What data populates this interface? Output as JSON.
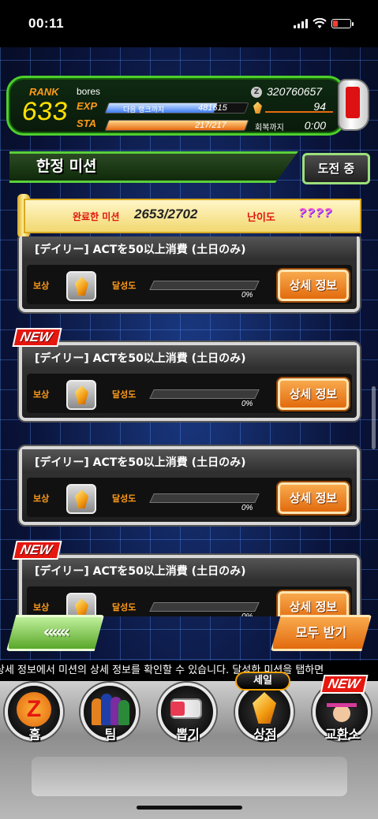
{
  "status_bar": {
    "time": "00:11"
  },
  "player": {
    "rank_label": "RANK",
    "rank": "633",
    "name": "bores",
    "exp_label": "EXP",
    "exp_next_label": "다음 랭크까지",
    "exp_value": "481615",
    "exp_progress": 0.78,
    "sta_label": "STA",
    "sta_value": "217/217",
    "sta_progress": 1.0,
    "zeni_icon": "Z",
    "zeni": "320760657",
    "dragon_stones": "94",
    "recover_label": "회복까지",
    "recover_time": "0:00"
  },
  "section": {
    "title": "한정 미션",
    "challenge_button": "도전 중"
  },
  "completed": {
    "label": "완료한 미션",
    "value": "2653/2702",
    "difficulty_label": "난이도",
    "difficulty_value": "????"
  },
  "missions": [
    {
      "title": "[デイリー] ACTを50以上消費 (土日のみ)",
      "reward_label": "보상",
      "progress_label": "달성도",
      "progress": "0%",
      "detail_button": "상세 정보",
      "new": false,
      "new_label": ""
    },
    {
      "title": "[デイリー] ACTを50以上消費 (土日のみ)",
      "reward_label": "보상",
      "progress_label": "달성도",
      "progress": "0%",
      "detail_button": "상세 정보",
      "new": true,
      "new_label": "NEW"
    },
    {
      "title": "[デイリー] ACTを50以上消費 (土日のみ)",
      "reward_label": "보상",
      "progress_label": "달성도",
      "progress": "0%",
      "detail_button": "상세 정보",
      "new": false,
      "new_label": ""
    },
    {
      "title": "[デイリー] ACTを50以上消費 (土日のみ)",
      "reward_label": "보상",
      "progress_label": "달성도",
      "progress": "0%",
      "detail_button": "상세 정보",
      "new": true,
      "new_label": "NEW"
    }
  ],
  "actions": {
    "back": "«««",
    "receive_all": "모두 받기"
  },
  "ticker": "상세 정보에서 미션의 상세 정보를 확인할 수 있습니다. 달성한 미션을 탭하면",
  "nav": {
    "home": "홈",
    "team": "팀",
    "gacha": "뽑기",
    "shop": "상점",
    "exchange": "교환소",
    "sale_badge": "세일",
    "new_badge": "NEW",
    "home_icon_letter": "Z"
  },
  "icons": {
    "reward": "dragon-stone-icon",
    "home": "dragon-ball-z-icon",
    "team": "team-characters-icon",
    "gacha": "summon-capsule-icon",
    "shop": "dragon-stone-icon",
    "exchange": "baba-icon"
  },
  "colors": {
    "accent_green": "#4ecf2c",
    "accent_orange": "#e26b0e",
    "label_orange": "#ff9b1a",
    "rank_yellow": "#ffe000",
    "new_red": "#e5170f"
  }
}
